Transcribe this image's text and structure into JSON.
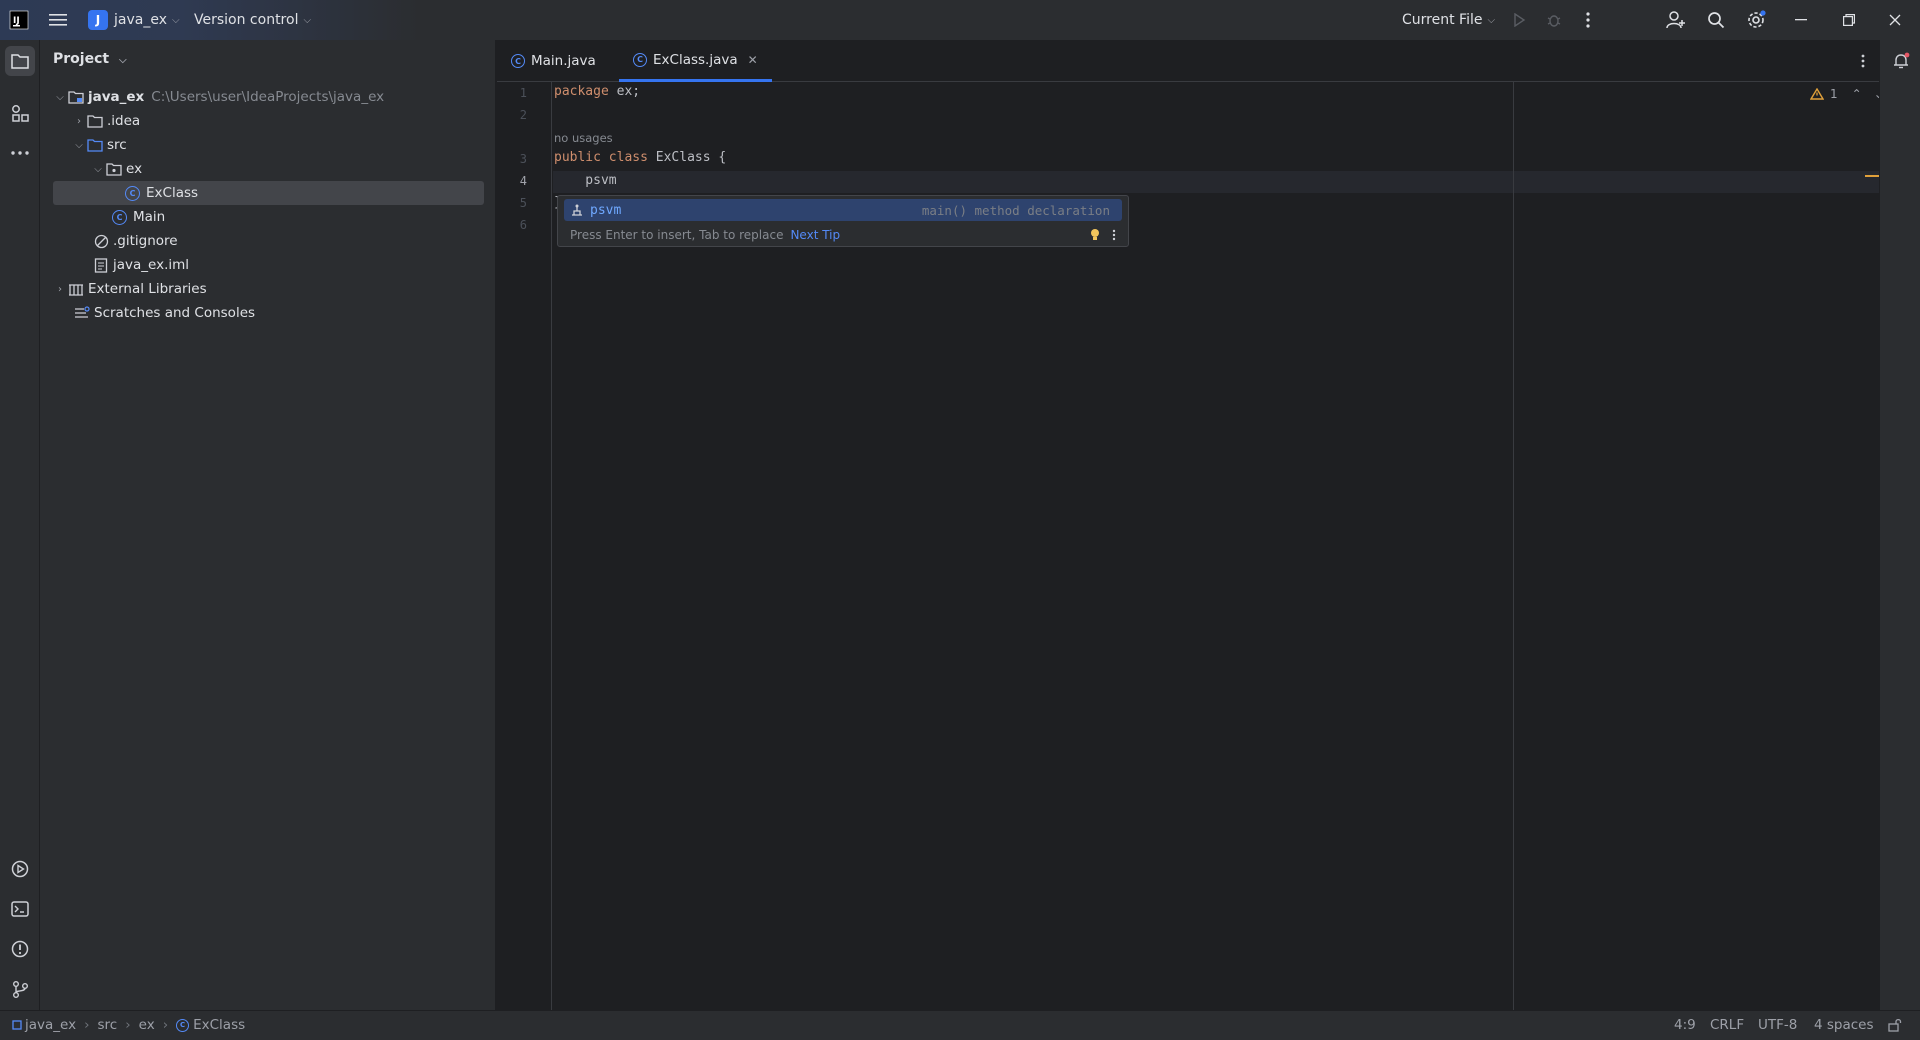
{
  "titlebar": {
    "project_badge": "J",
    "project_name": "java_ex",
    "vcs_label": "Version control",
    "run_config": "Current File"
  },
  "project_panel": {
    "title": "Project",
    "tree": [
      {
        "label": "java_ex",
        "hint": "C:\\Users\\user\\IdeaProjects\\java_ex"
      },
      {
        "label": ".idea"
      },
      {
        "label": "src"
      },
      {
        "label": "ex"
      },
      {
        "label": "ExClass"
      },
      {
        "label": "Main"
      },
      {
        "label": ".gitignore"
      },
      {
        "label": "java_ex.iml"
      },
      {
        "label": "External Libraries"
      },
      {
        "label": "Scratches and Consoles"
      }
    ]
  },
  "tabs": [
    {
      "label": "Main.java",
      "active": false
    },
    {
      "label": "ExClass.java",
      "active": true
    }
  ],
  "editor": {
    "line_numbers": [
      "1",
      "2",
      "3",
      "4",
      "5",
      "6"
    ],
    "line1_kw": "package",
    "line1_rest": " ex;",
    "usage_hint": "no usages",
    "line3_kw1": "public",
    "line3_kw2": "class",
    "line3_rest": " ExClass {",
    "line4": "    psvm",
    "line5": "}",
    "warnings_count": "1"
  },
  "completion_popup": {
    "item_name": "psvm",
    "item_desc": "main() method declaration",
    "footer_text": "Press Enter to insert, Tab to replace",
    "footer_link": "Next Tip"
  },
  "statusbar": {
    "breadcrumbs": [
      "java_ex",
      "src",
      "ex",
      "ExClass"
    ],
    "position": "4:9",
    "line_sep": "CRLF",
    "encoding": "UTF-8",
    "indent": "4 spaces"
  },
  "colors": {
    "accent": "#3574f0",
    "keyword": "#cf8e6d",
    "warning": "#e0a03a"
  }
}
